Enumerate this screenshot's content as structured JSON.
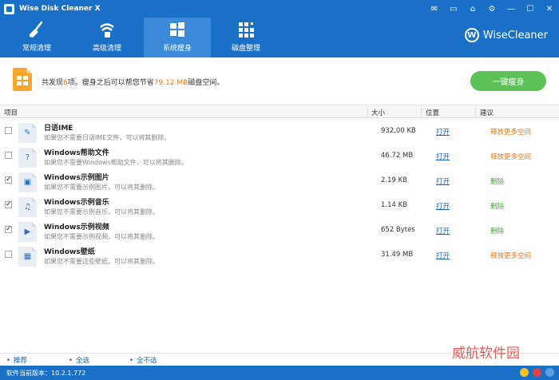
{
  "window": {
    "title": "Wise Disk Cleaner X",
    "controls": [
      "✉",
      "▭",
      "⌂",
      "⚙",
      "—",
      "☐",
      "✕"
    ]
  },
  "nav": {
    "tabs": [
      {
        "label": "常规清理",
        "icon": "broom-icon"
      },
      {
        "label": "高级清理",
        "icon": "vacuum-icon"
      },
      {
        "label": "系统瘦身",
        "icon": "windows-icon",
        "active": true
      },
      {
        "label": "磁盘整理",
        "icon": "defrag-icon"
      }
    ],
    "brand_logo": "W",
    "brand": "WiseCleaner"
  },
  "summary": {
    "prefix": "共发现",
    "count": "6",
    "mid": "项。瘦身之后可以帮您节省",
    "space": "79.12 MB",
    "suffix": "磁盘空间。",
    "button": "一键瘦身"
  },
  "columns": {
    "item": "项目",
    "size": "大小",
    "location": "位置",
    "suggestion": "建议"
  },
  "rows": [
    {
      "name": "日语IME",
      "desc": "如果您不需要日语IME文件，可以将其删除。",
      "size": "932.00 KB",
      "open": "打开",
      "suggestion": "释放更多空间",
      "checked": false,
      "icon": "✎",
      "icon_name": "pen-icon"
    },
    {
      "name": "Windows帮助文件",
      "desc": "如果您不需要Windows帮助文件，可以将其删除。",
      "size": "46.72 MB",
      "open": "打开",
      "suggestion": "释放更多空间",
      "checked": false,
      "icon": "?",
      "icon_name": "help-icon"
    },
    {
      "name": "Windows示例图片",
      "desc": "如果您不需要示例图片，可以将其删除。",
      "size": "2.19 KB",
      "open": "打开",
      "suggestion": "删除",
      "checked": true,
      "icon": "▣",
      "icon_name": "picture-icon"
    },
    {
      "name": "Windows示例音乐",
      "desc": "如果您不需要示例音乐，可以将其删除。",
      "size": "1.14 KB",
      "open": "打开",
      "suggestion": "删除",
      "checked": true,
      "icon": "♫",
      "icon_name": "music-icon"
    },
    {
      "name": "Windows示例视频",
      "desc": "如果您不需要示例视频，可以将其删除。",
      "size": "652 Bytes",
      "open": "打开",
      "suggestion": "删除",
      "checked": true,
      "icon": "▶",
      "icon_name": "video-icon"
    },
    {
      "name": "Windows壁纸",
      "desc": "如果您不需要这些壁纸，可以将其删除。",
      "size": "31.49 MB",
      "open": "打开",
      "suggestion": "释放更多空间",
      "checked": false,
      "icon": "▦",
      "icon_name": "wallpaper-icon"
    }
  ],
  "footer": {
    "recommend": "推荐",
    "select_all": "全选",
    "select_none": "全不选"
  },
  "status": {
    "version": "软件当前版本：10.2.1.772",
    "watermark": "威航软件园"
  },
  "colors": {
    "primary": "#1a6fc6",
    "active_tab": "#3a8ad9",
    "accent_orange": "#e8791a",
    "green": "#5cc157"
  }
}
